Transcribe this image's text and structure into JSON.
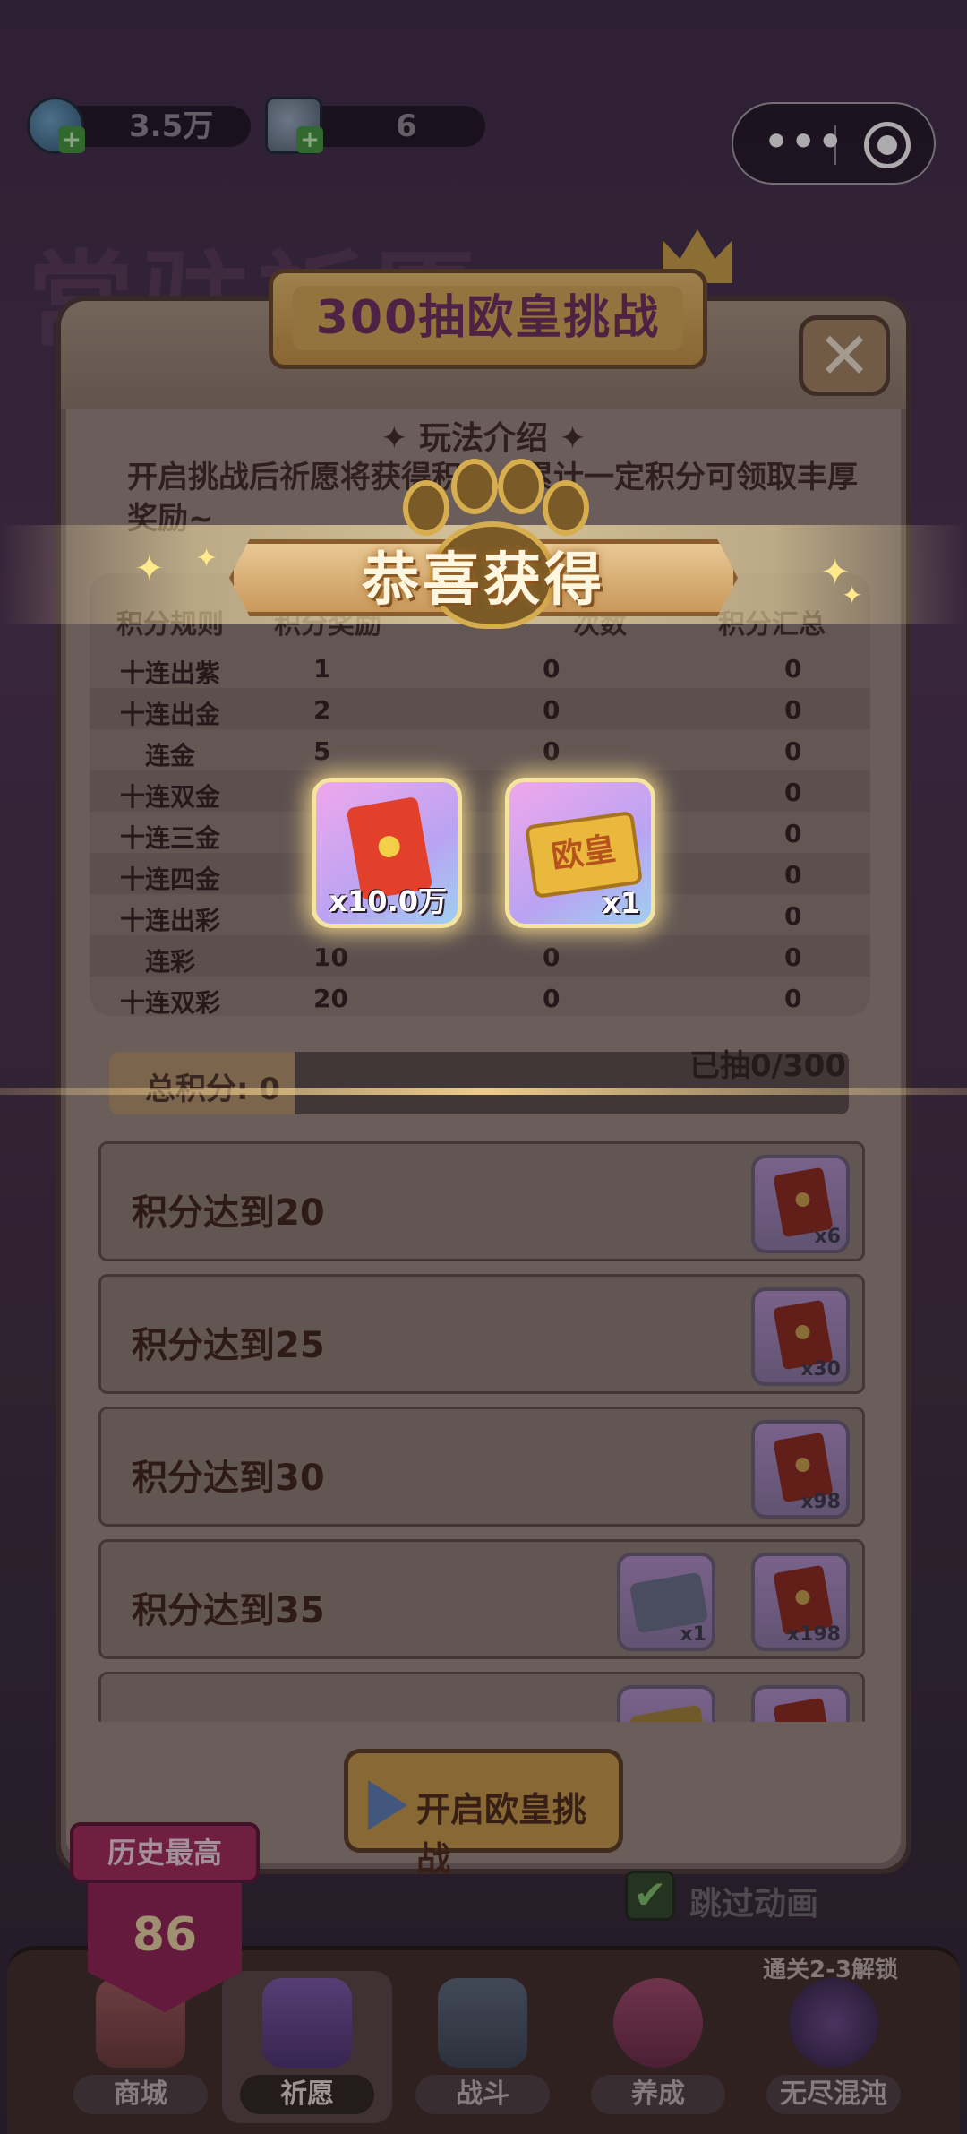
{
  "topbar": {
    "diamonds": "3.5万",
    "tickets": "6"
  },
  "background": {
    "title": "常驻祈愿"
  },
  "panel": {
    "title": "300抽欧皇挑战",
    "close": "✕",
    "rules_heading": "✦ 玩法介绍 ✦",
    "rules_text": "开启挑战后祈愿将获得积分，累计一定积分可领取丰厚奖励~",
    "table_headers": [
      "积分规则",
      "积分奖励",
      "次数",
      "积分汇总"
    ],
    "rows": [
      {
        "rule": "十连出紫",
        "points": "1",
        "count": "0",
        "total": "0"
      },
      {
        "rule": "十连出金",
        "points": "2",
        "count": "0",
        "total": "0"
      },
      {
        "rule": "连金",
        "points": "5",
        "count": "0",
        "total": "0"
      },
      {
        "rule": "十连双金",
        "points": "",
        "count": "",
        "total": "0"
      },
      {
        "rule": "十连三金",
        "points": "",
        "count": "",
        "total": "0"
      },
      {
        "rule": "十连四金",
        "points": "",
        "count": "",
        "total": "0"
      },
      {
        "rule": "十连出彩",
        "points": "",
        "count": "",
        "total": "0"
      },
      {
        "rule": "连彩",
        "points": "10",
        "count": "0",
        "total": "0"
      },
      {
        "rule": "十连双彩",
        "points": "20",
        "count": "0",
        "total": "0"
      }
    ],
    "total_label": "总积分: 0",
    "total_progress": 0.25,
    "drawn_label": "已抽0/300",
    "milestones": [
      {
        "label": "积分达到20",
        "rewards": [
          {
            "type": "envelope",
            "count": "x6"
          }
        ]
      },
      {
        "label": "积分达到25",
        "rewards": [
          {
            "type": "envelope",
            "count": "x30"
          }
        ]
      },
      {
        "label": "积分达到30",
        "rewards": [
          {
            "type": "envelope",
            "count": "x98"
          }
        ]
      },
      {
        "label": "积分达到35",
        "rewards": [
          {
            "type": "ticket",
            "count": "x1"
          },
          {
            "type": "envelope",
            "count": "x198"
          }
        ]
      },
      {
        "label": "",
        "rewards": [
          {
            "type": "ticket-gold",
            "count": ""
          },
          {
            "type": "envelope",
            "count": ""
          }
        ]
      }
    ],
    "start_button": "开启欧皇挑战",
    "skip_label": "跳过动画",
    "skip_checked": "✔"
  },
  "best": {
    "label": "历史最高",
    "value": "86"
  },
  "nav": {
    "unlock_hint": "通关2-3解锁",
    "items": [
      {
        "label": "商城"
      },
      {
        "label": "祈愿"
      },
      {
        "label": "战斗"
      },
      {
        "label": "养成"
      },
      {
        "label": "无尽混沌"
      }
    ],
    "active_index": 1
  },
  "popup": {
    "title": "恭喜获得",
    "prizes": [
      {
        "type": "red-envelope",
        "count": "x10.0万"
      },
      {
        "type": "ouhuang-ticket",
        "label": "欧皇",
        "count": "x1"
      }
    ]
  },
  "colors": {
    "accent_gold": "#d6ad4f",
    "envelope_red": "#e2402a",
    "panel_bg": "#9a8b7e",
    "best_red": "#a12a59"
  }
}
